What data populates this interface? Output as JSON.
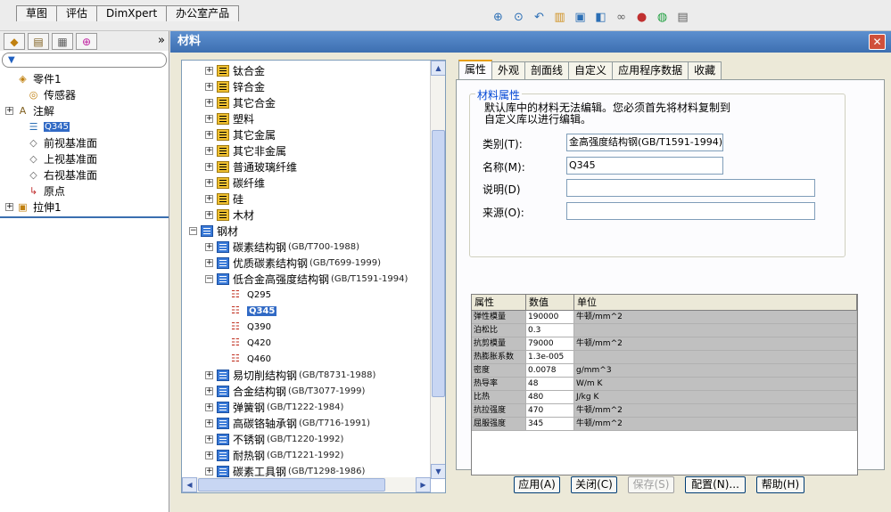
{
  "top_tabs": [
    "草图",
    "评估",
    "DimXpert",
    "办公室产品"
  ],
  "left_panel": {
    "more_label": "»",
    "filter_label": "▼",
    "tree": [
      {
        "label": "零件1",
        "icon": "part-icon",
        "indent": 0,
        "expand": ""
      },
      {
        "label": "传感器",
        "icon": "sensor-icon",
        "indent": 1,
        "expand": ""
      },
      {
        "label": "注解",
        "icon": "annotation-icon",
        "indent": 0,
        "expand": "+"
      },
      {
        "label": "Q345",
        "icon": "material-icon",
        "indent": 1,
        "expand": "",
        "selected": true
      },
      {
        "label": "前视基准面",
        "icon": "plane-icon",
        "indent": 1,
        "expand": ""
      },
      {
        "label": "上视基准面",
        "icon": "plane-icon",
        "indent": 1,
        "expand": ""
      },
      {
        "label": "右视基准面",
        "icon": "plane-icon",
        "indent": 1,
        "expand": ""
      },
      {
        "label": "原点",
        "icon": "origin-icon",
        "indent": 1,
        "expand": ""
      },
      {
        "label": "拉伸1",
        "icon": "extrude-icon",
        "indent": 0,
        "expand": "+"
      }
    ]
  },
  "dialog": {
    "title": "材料",
    "close_label": "✕",
    "material_tree": [
      {
        "label": "钛合金",
        "std": "",
        "level": 1,
        "kind": "folder",
        "expand": "+"
      },
      {
        "label": "锌合金",
        "std": "",
        "level": 1,
        "kind": "folder",
        "expand": "+"
      },
      {
        "label": "其它合金",
        "std": "",
        "level": 1,
        "kind": "folder",
        "expand": "+"
      },
      {
        "label": "塑料",
        "std": "",
        "level": 1,
        "kind": "folder",
        "expand": "+"
      },
      {
        "label": "其它金属",
        "std": "",
        "level": 1,
        "kind": "folder",
        "expand": "+"
      },
      {
        "label": "其它非金属",
        "std": "",
        "level": 1,
        "kind": "folder",
        "expand": "+"
      },
      {
        "label": "普通玻璃纤维",
        "std": "",
        "level": 1,
        "kind": "folder",
        "expand": "+"
      },
      {
        "label": "碳纤维",
        "std": "",
        "level": 1,
        "kind": "folder",
        "expand": "+"
      },
      {
        "label": "硅",
        "std": "",
        "level": 1,
        "kind": "folder",
        "expand": "+"
      },
      {
        "label": "木材",
        "std": "",
        "level": 1,
        "kind": "folder",
        "expand": "+"
      },
      {
        "label": "钢材",
        "std": "",
        "level": 0,
        "kind": "lib",
        "expand": "−"
      },
      {
        "label": "碳素结构钢",
        "std": "(GB/T700-1988)",
        "level": 1,
        "kind": "lib",
        "expand": "+"
      },
      {
        "label": "优质碳素结构钢",
        "std": "(GB/T699-1999)",
        "level": 1,
        "kind": "lib",
        "expand": "+"
      },
      {
        "label": "低合金高强度结构钢",
        "std": "(GB/T1591-1994)",
        "level": 1,
        "kind": "lib",
        "expand": "−"
      },
      {
        "label": "Q295",
        "std": "",
        "level": 2,
        "kind": "mat",
        "expand": ""
      },
      {
        "label": "Q345",
        "std": "",
        "level": 2,
        "kind": "mat",
        "expand": "",
        "selected": true
      },
      {
        "label": "Q390",
        "std": "",
        "level": 2,
        "kind": "mat",
        "expand": ""
      },
      {
        "label": "Q420",
        "std": "",
        "level": 2,
        "kind": "mat",
        "expand": ""
      },
      {
        "label": "Q460",
        "std": "",
        "level": 2,
        "kind": "mat",
        "expand": ""
      },
      {
        "label": "易切削结构钢",
        "std": "(GB/T8731-1988)",
        "level": 1,
        "kind": "lib",
        "expand": "+"
      },
      {
        "label": "合金结构钢",
        "std": "(GB/T3077-1999)",
        "level": 1,
        "kind": "lib",
        "expand": "+"
      },
      {
        "label": "弹簧钢",
        "std": "(GB/T1222-1984)",
        "level": 1,
        "kind": "lib",
        "expand": "+"
      },
      {
        "label": "高碳铬轴承钢",
        "std": "(GB/T716-1991)",
        "level": 1,
        "kind": "lib",
        "expand": "+"
      },
      {
        "label": "不锈钢",
        "std": "(GB/T1220-1992)",
        "level": 1,
        "kind": "lib",
        "expand": "+"
      },
      {
        "label": "耐热钢",
        "std": "(GB/T1221-1992)",
        "level": 1,
        "kind": "lib",
        "expand": "+"
      },
      {
        "label": "碳素工具钢",
        "std": "(GB/T1298-1986)",
        "level": 1,
        "kind": "lib",
        "expand": "+"
      }
    ],
    "tabs": [
      "属性",
      "外观",
      "剖面线",
      "自定义",
      "应用程序数据",
      "收藏"
    ],
    "group_title": "材料属性",
    "note": "默认库中的材料无法编辑。您必须首先将材料复制到\n自定义库以进行编辑。",
    "fields": [
      {
        "label": "类别(T):",
        "value": "金高强度结构钢(GB/T1591-1994)"
      },
      {
        "label": "名称(M):",
        "value": "Q345"
      },
      {
        "label": "说明(D)",
        "value": ""
      },
      {
        "label": "来源(O):",
        "value": ""
      }
    ],
    "table": {
      "headers": [
        "属性",
        "数值",
        "单位"
      ],
      "rows": [
        [
          "弹性模量",
          "190000",
          "牛顿/mm^2"
        ],
        [
          "泊松比",
          "0.3",
          ""
        ],
        [
          "抗剪模量",
          "79000",
          "牛顿/mm^2"
        ],
        [
          "热膨胀系数",
          "1.3e-005",
          ""
        ],
        [
          "密度",
          "0.0078",
          "g/mm^3"
        ],
        [
          "热导率",
          "48",
          "W/m K"
        ],
        [
          "比热",
          "480",
          "J/kg K"
        ],
        [
          "抗拉强度",
          "470",
          "牛顿/mm^2"
        ],
        [
          "屈服强度",
          "345",
          "牛顿/mm^2"
        ]
      ]
    },
    "buttons": [
      "应用(A)",
      "关闭(C)",
      "保存(S)",
      "配置(N)...",
      "帮助(H)"
    ]
  }
}
